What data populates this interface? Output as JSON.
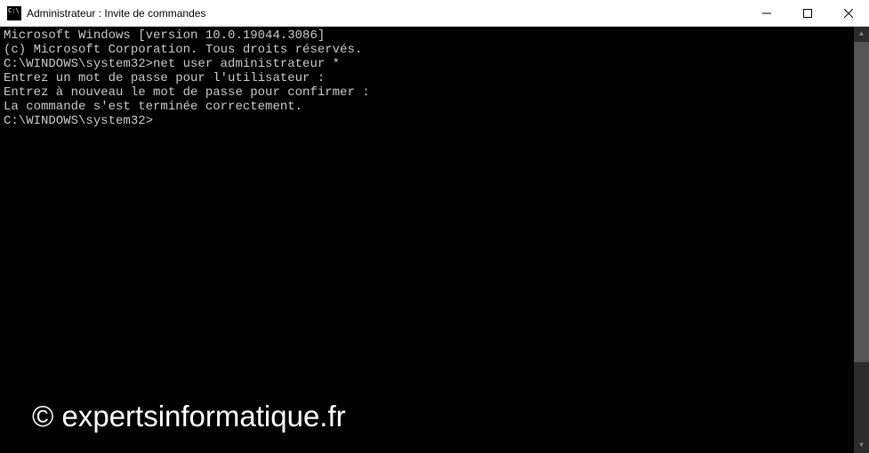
{
  "titlebar": {
    "title": "Administrateur : Invite de commandes"
  },
  "terminal": {
    "lines": [
      "Microsoft Windows [version 10.0.19044.3086]",
      "(c) Microsoft Corporation. Tous droits réservés.",
      "",
      "C:\\WINDOWS\\system32>net user administrateur *",
      "Entrez un mot de passe pour l'utilisateur :",
      "Entrez à nouveau le mot de passe pour confirmer :",
      "La commande s'est terminée correctement.",
      "",
      "",
      "C:\\WINDOWS\\system32>"
    ]
  },
  "watermark": "© expertsinformatique.fr"
}
